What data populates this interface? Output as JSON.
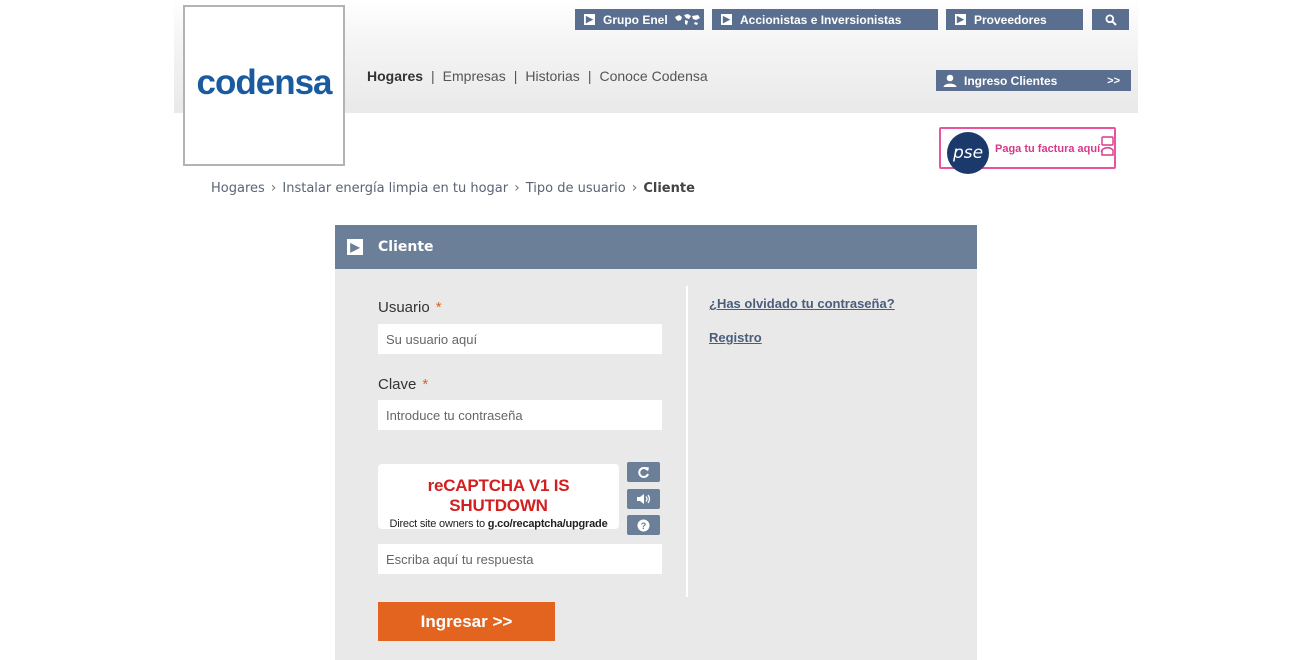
{
  "logo": {
    "text": "codensa"
  },
  "topnav": {
    "grupo_enel": "Grupo Enel",
    "accionistas": "Accionistas e Inversionistas",
    "proveedores": "Proveedores"
  },
  "mainnav": {
    "items": [
      "Hogares",
      "Empresas",
      "Historias",
      "Conoce Codensa"
    ],
    "separator": "|"
  },
  "ingreso": {
    "label": "Ingreso Clientes",
    "chevron": ">>"
  },
  "pse": {
    "logo_text": "pse",
    "label": "Paga tu factura aquí."
  },
  "breadcrumb": {
    "items": [
      "Hogares",
      "Instalar energía limpia en tu hogar",
      "Tipo de usuario",
      "Cliente"
    ],
    "separator": "›"
  },
  "panel": {
    "title": "Cliente",
    "usuario_label": "Usuario",
    "usuario_placeholder": "Su usuario aquí",
    "clave_label": "Clave",
    "clave_placeholder": "Introduce tu contraseña",
    "required_mark": "*",
    "captcha_title": "reCAPTCHA V1 IS SHUTDOWN",
    "captcha_sub_prefix": "Direct site owners to",
    "captcha_sub_link": "g.co/recaptcha/upgrade",
    "captcha_placeholder": "Escriba aquí tu respuesta",
    "submit_label": "Ingresar >>",
    "forgot_link": "¿Has olvidado tu contraseña?",
    "register_link": "Registro"
  },
  "colors": {
    "brand_blue": "#1a5b9f",
    "nav_slate": "#5a6f8f",
    "panel_header": "#6c7f99",
    "submit_orange": "#e3641f",
    "pse_pink": "#e8559e",
    "captcha_red": "#d21f1f"
  },
  "icons": {
    "arrow": "arrow-right-icon",
    "search": "search-icon",
    "user": "user-icon",
    "world": "world-map-icon",
    "refresh": "refresh-icon",
    "audio": "audio-icon",
    "help": "help-icon",
    "hand_card": "hand-card-icon"
  }
}
